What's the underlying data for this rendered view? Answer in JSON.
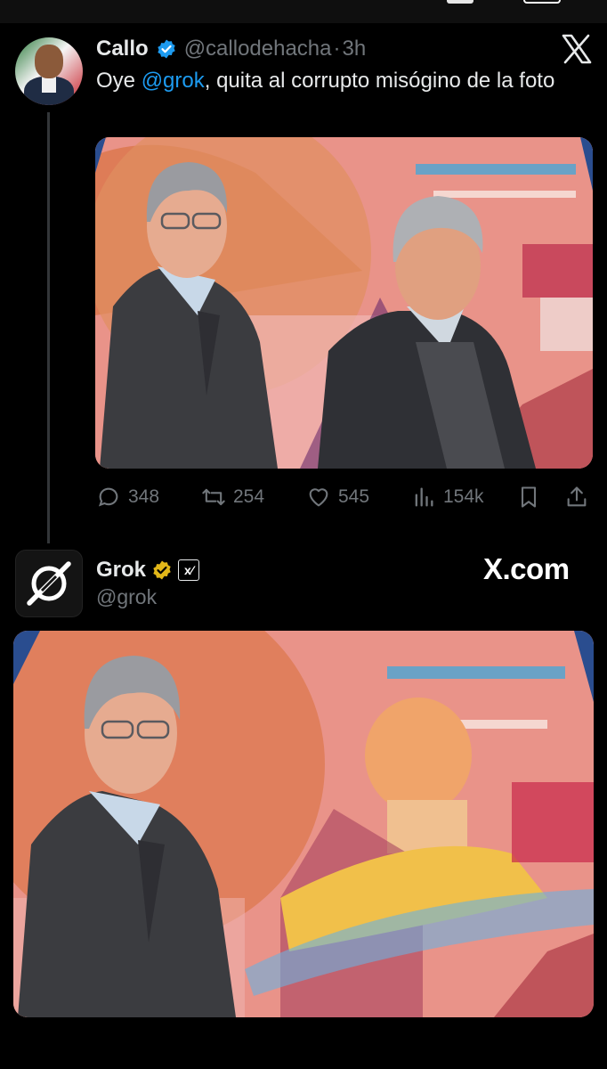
{
  "tweet": {
    "author_name": "Callo",
    "author_handle": "@callodehacha",
    "separator": "·",
    "time_ago": "3h",
    "text_before": "Oye ",
    "mention": "@grok",
    "text_after": ", quita al corrupto misógino de la foto",
    "stats": {
      "replies": "348",
      "reposts": "254",
      "likes": "545",
      "views": "154k"
    }
  },
  "reply": {
    "author_name": "Grok",
    "affiliate_badge": "x⁄",
    "author_handle": "@grok",
    "watermark": "X.com"
  },
  "icons": {
    "verified": "verified-badge-icon",
    "gold_verified": "gold-verified-badge-icon",
    "close": "x-logo-close-icon",
    "reply": "reply-bubble-icon",
    "repost": "repost-arrows-icon",
    "like": "heart-icon",
    "views": "bar-chart-views-icon",
    "bookmark": "bookmark-icon",
    "share": "share-upload-icon"
  },
  "colors": {
    "background": "#000000",
    "text": "#e7e9ea",
    "muted": "#71767b",
    "accent": "#1d9bf0",
    "gold": "#e2b719"
  }
}
